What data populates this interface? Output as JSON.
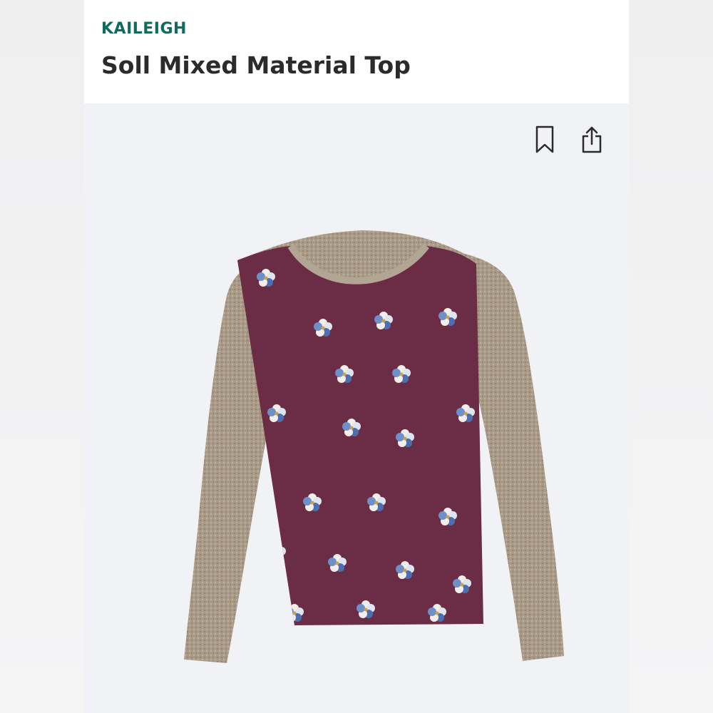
{
  "product": {
    "brand": "KAILEIGH",
    "name": "Soll Mixed Material Top"
  },
  "actions": {
    "save_icon": "bookmark-icon",
    "share_icon": "share-icon"
  },
  "colors": {
    "brand_accent": "#0f6b5c",
    "body_panel": "#6b2c46",
    "sleeve": "#a89a86"
  }
}
